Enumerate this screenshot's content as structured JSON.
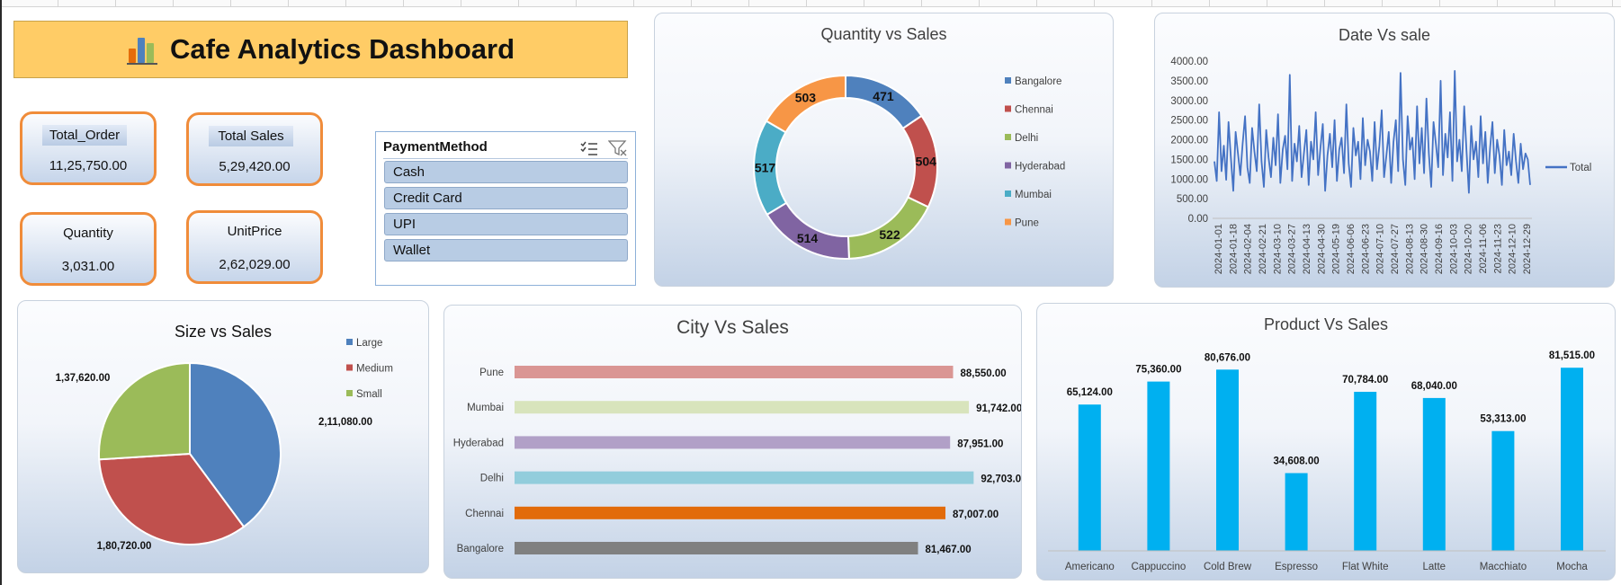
{
  "dashboard": {
    "title": "Cafe Analytics Dashboard",
    "title_icon": "bar-chart-icon"
  },
  "kpis": [
    {
      "label": "Total_Order",
      "value": "11,25,750.00"
    },
    {
      "label": "Total Sales",
      "value": "5,29,420.00"
    },
    {
      "label": "Quantity",
      "value": "3,031.00"
    },
    {
      "label": "UnitPrice",
      "value": "2,62,029.00"
    }
  ],
  "slicer": {
    "title": "PaymentMethod",
    "icons": [
      "multi-select-icon",
      "clear-filter-icon"
    ],
    "items": [
      "Cash",
      "Credit Card",
      "UPI",
      "Wallet"
    ]
  },
  "colors": {
    "accent_orange": "#f08c3a",
    "banner": "#ffcc66",
    "line_blue": "#4472c4",
    "product_bar": "#00b0f0"
  },
  "chart_data": [
    {
      "id": "quantity-vs-sales",
      "type": "pie",
      "variant": "doughnut",
      "title": "Quantity vs Sales",
      "labels": [
        "Bangalore",
        "Chennai",
        "Delhi",
        "Hyderabad",
        "Mumbai",
        "Pune"
      ],
      "values": [
        471,
        504,
        522,
        514,
        517,
        503
      ],
      "data_labels": [
        "471",
        "504",
        "522",
        "514",
        "517",
        "503"
      ],
      "colors": [
        "#4f81bd",
        "#c0504d",
        "#9bbb59",
        "#8064a2",
        "#4bacc6",
        "#f79646"
      ],
      "legend": "right"
    },
    {
      "id": "date-vs-sale",
      "type": "line",
      "title": "Date Vs sale",
      "series": [
        {
          "name": "Total",
          "color": "#4472c4"
        }
      ],
      "y_ticks": [
        "4000.00",
        "3500.00",
        "3000.00",
        "2500.00",
        "2000.00",
        "1500.00",
        "1000.00",
        "500.00",
        "0.00"
      ],
      "ylim": [
        0,
        4000
      ],
      "x_ticks": [
        "2024-01-01",
        "2024-01-18",
        "2024-02-04",
        "2024-02-21",
        "2024-03-10",
        "2024-03-27",
        "2024-04-13",
        "2024-04-30",
        "2024-05-19",
        "2024-06-06",
        "2024-06-23",
        "2024-07-10",
        "2024-07-27",
        "2024-08-13",
        "2024-08-30",
        "2024-09-16",
        "2024-10-03",
        "2024-10-20",
        "2024-11-06",
        "2024-11-23",
        "2024-12-10",
        "2024-12-29"
      ],
      "values": [
        1450,
        950,
        2700,
        1200,
        1850,
        980,
        2450,
        1550,
        700,
        2200,
        1650,
        1100,
        1900,
        2600,
        1300,
        900,
        2300,
        1700,
        1200,
        2900,
        1450,
        800,
        2250,
        1550,
        1050,
        2050,
        1350,
        2650,
        900,
        1750,
        2100,
        1250,
        3650,
        950,
        1900,
        1450,
        2350,
        1050,
        1650,
        2250,
        850,
        1950,
        1500,
        2700,
        1100,
        1800,
        2400,
        700,
        1600,
        2150,
        1300,
        2500,
        950,
        1750,
        2050,
        1150,
        2900,
        1400,
        800,
        2300,
        1600,
        1950,
        1000,
        2550,
        1350,
        2000,
        1700,
        950,
        2450,
        1250,
        1850,
        2750,
        1050,
        1600,
        2200,
        900,
        1950,
        2500,
        1200,
        3700,
        1500,
        850,
        2600,
        1750,
        2050,
        1000,
        2850,
        1400,
        2300,
        1150,
        3050,
        1650,
        800,
        2450,
        1900,
        1300,
        3500,
        1100,
        2150,
        1550,
        2700,
        950,
        3750,
        1450,
        2000,
        1200,
        2850,
        1700,
        650,
        2350,
        1500,
        1950,
        1050,
        2600,
        1400,
        2200,
        900,
        1800,
        2450,
        1150,
        2000,
        1600,
        850,
        2250,
        1350,
        1700,
        1100,
        2150,
        1450,
        900,
        1900,
        1250,
        1650,
        1500,
        850
      ]
    },
    {
      "id": "size-vs-sales",
      "type": "pie",
      "title": "Size vs Sales",
      "labels": [
        "Large",
        "Medium",
        "Small"
      ],
      "values": [
        211080,
        180720,
        137620
      ],
      "data_labels": [
        "2,11,080.00",
        "1,80,720.00",
        "1,37,620.00"
      ],
      "colors": [
        "#4f81bd",
        "#c0504d",
        "#9bbb59"
      ],
      "legend": "top-right"
    },
    {
      "id": "city-vs-sales",
      "type": "bar",
      "orientation": "horizontal",
      "title": "City Vs Sales",
      "categories": [
        "Pune",
        "Mumbai",
        "Hyderabad",
        "Delhi",
        "Chennai",
        "Bangalore"
      ],
      "values": [
        88550,
        91742,
        87951,
        92703,
        87007,
        81467
      ],
      "data_labels": [
        "88,550.00",
        "91,742.00",
        "87,951.00",
        "92,703.00",
        "87,007.00",
        "81,467.00"
      ],
      "colors": [
        "#da9694",
        "#d8e4bc",
        "#b1a0c7",
        "#92cddc",
        "#e26b0a",
        "#808080"
      ],
      "xlim": [
        0,
        93000
      ]
    },
    {
      "id": "product-vs-sales",
      "type": "bar",
      "title": "Product Vs Sales",
      "categories": [
        "Americano",
        "Cappuccino",
        "Cold Brew",
        "Espresso",
        "Flat White",
        "Latte",
        "Macchiato",
        "Mocha"
      ],
      "values": [
        65124,
        75360,
        80676,
        34608,
        70784,
        68040,
        53313,
        81515
      ],
      "data_labels": [
        "65,124.00",
        "75,360.00",
        "80,676.00",
        "34,608.00",
        "70,784.00",
        "68,040.00",
        "53,313.00",
        "81,515.00"
      ],
      "color": "#00b0f0",
      "ylim": [
        0,
        82000
      ]
    }
  ]
}
